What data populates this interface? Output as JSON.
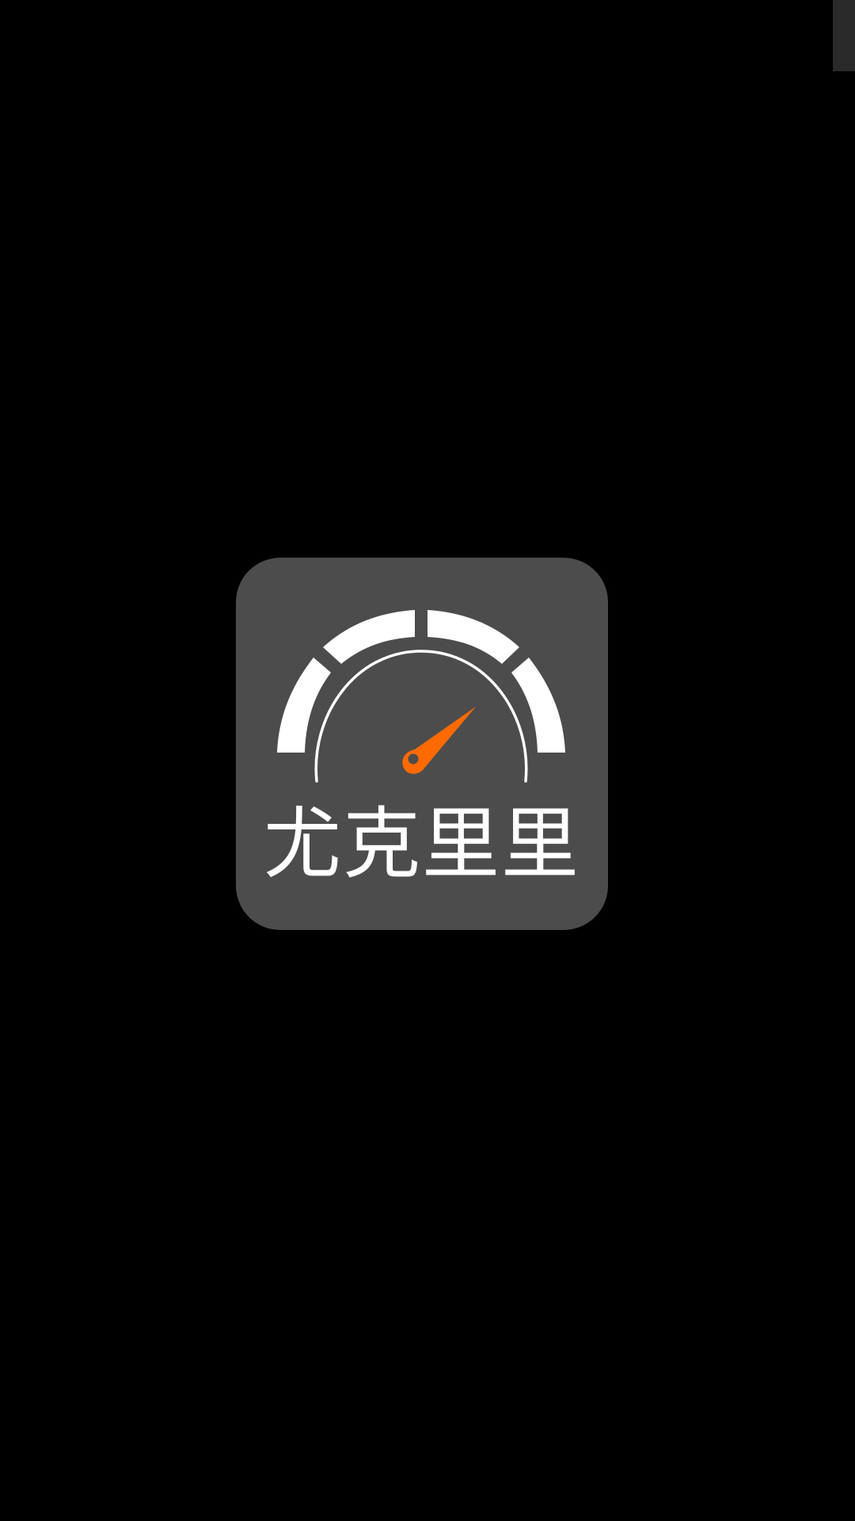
{
  "splash": {
    "app_name": "尤克里里",
    "logo_background_color": "#4c4c4c",
    "needle_color": "#ff6a00",
    "dial_color": "#ffffff",
    "screen_background_color": "#000000"
  },
  "icons": {
    "logo": "speedometer-gauge-icon"
  }
}
